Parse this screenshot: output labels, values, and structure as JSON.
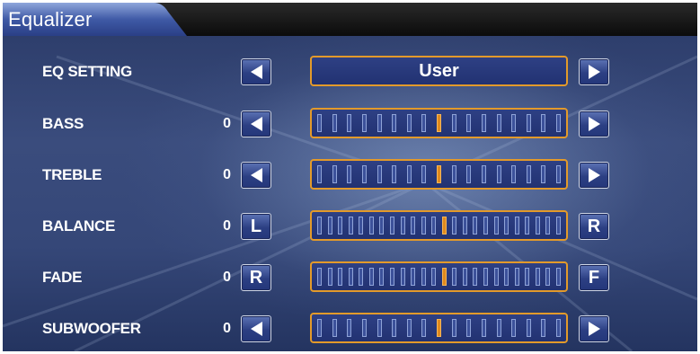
{
  "window": {
    "title": "Equalizer"
  },
  "eq_setting": {
    "label": "EQ SETTING",
    "preset": "User"
  },
  "rows": [
    {
      "key": "bass",
      "label": "BASS",
      "value": "0",
      "left_button": "left-arrow-icon",
      "right_button": "right-arrow-icon",
      "ticks": 17,
      "active_tick": 8
    },
    {
      "key": "treble",
      "label": "TREBLE",
      "value": "0",
      "left_button": "left-arrow-icon",
      "right_button": "right-arrow-icon",
      "ticks": 17,
      "active_tick": 8
    },
    {
      "key": "balance",
      "label": "BALANCE",
      "value": "0",
      "left_label": "L",
      "right_label": "R",
      "ticks": 24,
      "active_tick": 12
    },
    {
      "key": "fade",
      "label": "FADE",
      "value": "0",
      "left_label": "R",
      "right_label": "F",
      "ticks": 24,
      "active_tick": 12
    },
    {
      "key": "subwoofer",
      "label": "SUBWOOFER",
      "value": "0",
      "left_button": "left-arrow-icon",
      "right_button": "right-arrow-icon",
      "ticks": 17,
      "active_tick": 8
    }
  ],
  "colors": {
    "accent_border": "#e39a2a",
    "active_tick": "#e08a1e",
    "button_face": "#2c3f83",
    "background": "#2a3a67"
  }
}
